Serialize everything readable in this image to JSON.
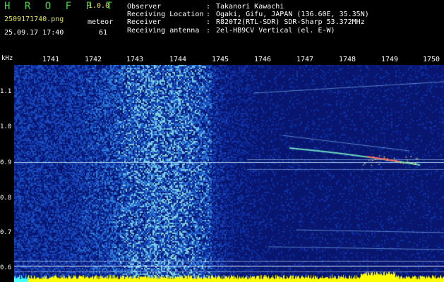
{
  "header": {
    "app_title": "H R O F F T",
    "version": "1.0.0",
    "file_name": "2509171740.png",
    "mode": "meteor",
    "timestamp": "25.09.17 17:40",
    "count": "61",
    "info": [
      {
        "key": "Observer",
        "value": "Takanori Kawachi"
      },
      {
        "key": "Receiving Location",
        "value": "Ogaki, Gifu, JAPAN (136.60E, 35.35N)"
      },
      {
        "key": "Receiver",
        "value": "R820T2(RTL-SDR) SDR-Sharp 53.372MHz"
      },
      {
        "key": "Receiving antenna",
        "value": "2el-HB9CV Vertical (el. E-W)"
      }
    ]
  },
  "axis": {
    "unit": "kHz",
    "x_ticks": [
      "1741",
      "1742",
      "1743",
      "1744",
      "1745",
      "1746",
      "1747",
      "1748",
      "1749",
      "1750"
    ],
    "y_ticks": [
      "1.1",
      "1.0",
      "0.9",
      "0.8",
      "0.7",
      "0.6"
    ]
  },
  "colors": {
    "background": "#000000",
    "spectrum_base": "#0a1a7a",
    "noise": "#2f6bd8",
    "signal": "#ff4040",
    "baseline": "#ffff00",
    "title": "#4cd24c"
  }
}
